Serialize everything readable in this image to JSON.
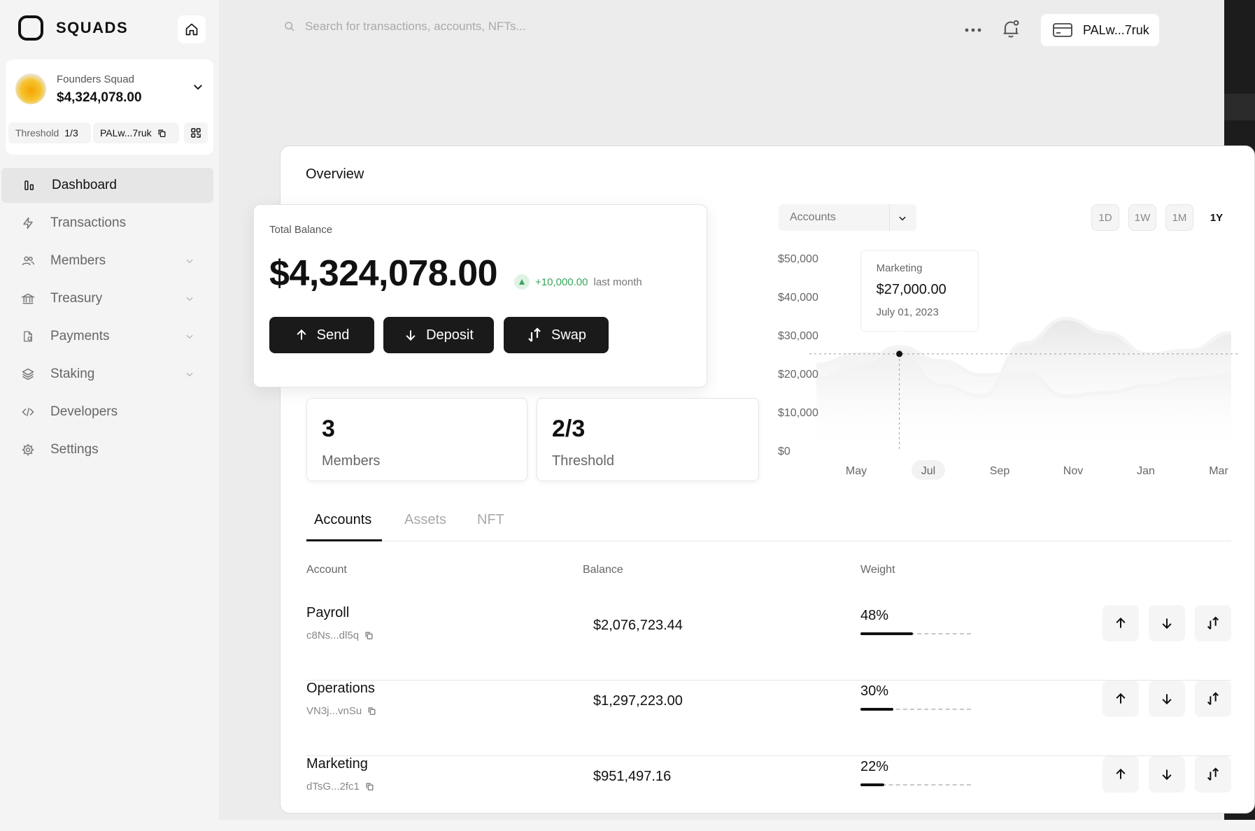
{
  "app": {
    "name": "SQUADS"
  },
  "squad": {
    "name": "Founders Squad",
    "balance": "$4,324,078.00",
    "threshold_label": "Threshold",
    "threshold_value": "1/3",
    "address": "PALw...7ruk"
  },
  "nav": [
    {
      "label": "Dashboard",
      "icon": "dashboard-icon",
      "active": true,
      "chevron": false
    },
    {
      "label": "Transactions",
      "icon": "lightning-icon",
      "active": false,
      "chevron": false
    },
    {
      "label": "Members",
      "icon": "users-icon",
      "active": false,
      "chevron": true
    },
    {
      "label": "Treasury",
      "icon": "bank-icon",
      "active": false,
      "chevron": true
    },
    {
      "label": "Payments",
      "icon": "document-icon",
      "active": false,
      "chevron": true
    },
    {
      "label": "Staking",
      "icon": "layers-icon",
      "active": false,
      "chevron": true
    },
    {
      "label": "Developers",
      "icon": "code-icon",
      "active": false,
      "chevron": false
    },
    {
      "label": "Settings",
      "icon": "gear-icon",
      "active": false,
      "chevron": false
    }
  ],
  "topbar": {
    "search_placeholder": "Search for transactions, accounts, NFTs...",
    "wallet_label": "PALw...7ruk"
  },
  "overview": {
    "title": "Overview",
    "total_balance_label": "Total Balance",
    "total_balance": "$4,324,078.00",
    "delta_value": "+10,000.00",
    "delta_period": "last month",
    "actions": [
      "Send",
      "Deposit",
      "Swap"
    ],
    "members_count": "3",
    "members_label": "Members",
    "threshold_value": "2/3",
    "threshold_label": "Threshold"
  },
  "chart_controls": {
    "selector_value": "Accounts",
    "timeframes": [
      "1D",
      "1W",
      "1M",
      "1Y"
    ],
    "active_timeframe": "1Y"
  },
  "chart_data": {
    "type": "area",
    "title": "",
    "xlabel": "",
    "ylabel": "",
    "x_ticks": [
      "May",
      "Jul",
      "Sep",
      "Nov",
      "Jan",
      "Mar"
    ],
    "highlight_x_tick": "Jul",
    "y_ticks": [
      "$50,000",
      "$40,000",
      "$30,000",
      "$20,000",
      "$10,000",
      "$0"
    ],
    "ylim": [
      0,
      50000
    ],
    "grid": false,
    "series": [
      {
        "points": [
          [
            "May",
            24000
          ],
          [
            "Jun",
            27000
          ],
          [
            "Jul",
            27000
          ],
          [
            "Aug",
            18000
          ],
          [
            "Sep",
            15000
          ],
          [
            "Oct",
            30000
          ],
          [
            "Nov",
            37000
          ],
          [
            "Dec",
            33000
          ],
          [
            "Jan",
            27000
          ],
          [
            "Feb",
            28000
          ],
          [
            "Mar",
            33000
          ]
        ]
      },
      {
        "points": [
          [
            "May",
            20000
          ],
          [
            "Jun",
            24000
          ],
          [
            "Jul",
            29000
          ],
          [
            "Aug",
            25000
          ],
          [
            "Sep",
            21000
          ],
          [
            "Oct",
            22000
          ],
          [
            "Nov",
            15000
          ],
          [
            "Dec",
            16000
          ],
          [
            "Jan",
            18000
          ],
          [
            "Feb",
            20000
          ],
          [
            "Mar",
            21000
          ]
        ]
      }
    ],
    "reference_line": 27000,
    "tooltip": {
      "label": "Marketing",
      "value": "$27,000.00",
      "date": "July 01, 2023",
      "x": "Jul",
      "y": 27000
    }
  },
  "tabs": [
    {
      "label": "Accounts",
      "active": true
    },
    {
      "label": "Assets",
      "active": false
    },
    {
      "label": "NFT",
      "active": false
    }
  ],
  "table": {
    "headers": [
      "Account",
      "Balance",
      "Weight"
    ],
    "rows": [
      {
        "name": "Payroll",
        "address": "c8Ns...dl5q",
        "balance": "$2,076,723.44",
        "weight_label": "48%",
        "weight": 0.48
      },
      {
        "name": "Operations",
        "address": "VN3j...vnSu",
        "balance": "$1,297,223.00",
        "weight_label": "30%",
        "weight": 0.3
      },
      {
        "name": "Marketing",
        "address": "dTsG...2fc1",
        "balance": "$951,497.16",
        "weight_label": "22%",
        "weight": 0.22
      }
    ]
  }
}
